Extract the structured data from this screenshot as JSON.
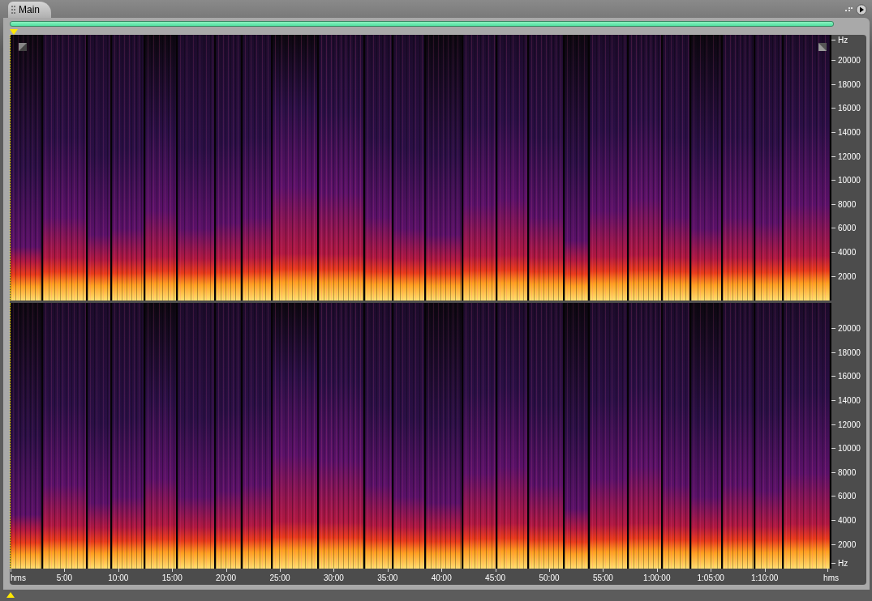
{
  "panel": {
    "tab": "Main"
  },
  "channels": [
    {
      "unit_top": "Hz",
      "labels": [
        "20000",
        "18000",
        "16000",
        "14000",
        "12000",
        "10000",
        "8000",
        "6000",
        "4000",
        "2000"
      ]
    },
    {
      "unit_bottom": "Hz",
      "labels": [
        "20000",
        "18000",
        "16000",
        "14000",
        "12000",
        "10000",
        "8000",
        "6000",
        "4000",
        "2000"
      ]
    }
  ],
  "time_axis": {
    "labels": [
      "hms",
      "5:00",
      "10:00",
      "15:00",
      "20:00",
      "25:00",
      "30:00",
      "35:00",
      "40:00",
      "45:00",
      "50:00",
      "55:00",
      "1:00:00",
      "1:05:00",
      "1:10:00",
      "hms"
    ]
  }
}
